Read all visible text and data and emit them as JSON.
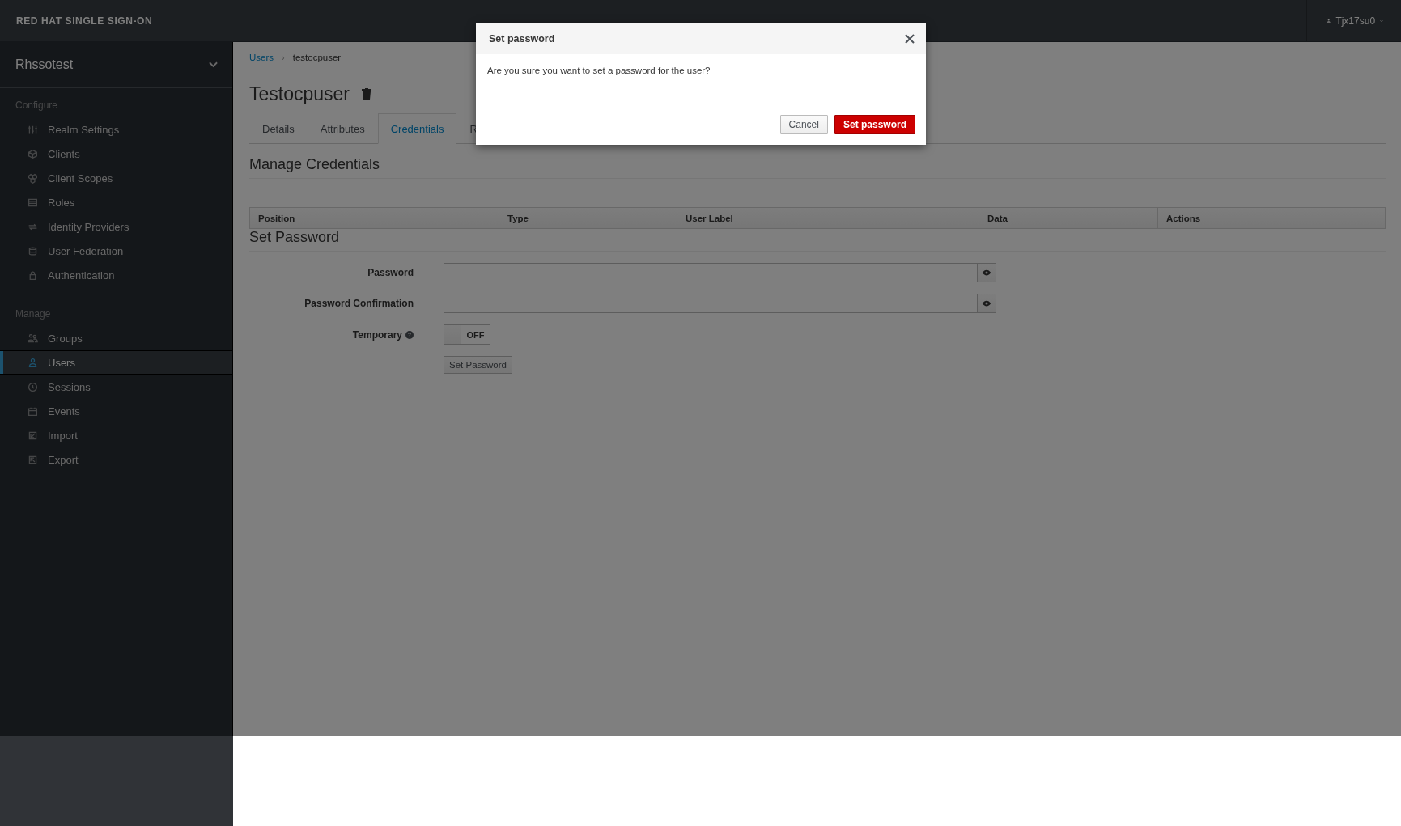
{
  "brand": "RED HAT SINGLE SIGN-ON",
  "user_menu": {
    "name": "Tjx17su0"
  },
  "realm": "Rhssotest",
  "sidebar": {
    "sections": [
      {
        "title": "Configure",
        "items": [
          {
            "label": "Realm Settings",
            "selected": false
          },
          {
            "label": "Clients",
            "selected": false
          },
          {
            "label": "Client Scopes",
            "selected": false
          },
          {
            "label": "Roles",
            "selected": false
          },
          {
            "label": "Identity Providers",
            "selected": false
          },
          {
            "label": "User Federation",
            "selected": false
          },
          {
            "label": "Authentication",
            "selected": false
          }
        ]
      },
      {
        "title": "Manage",
        "items": [
          {
            "label": "Groups",
            "selected": false
          },
          {
            "label": "Users",
            "selected": true
          },
          {
            "label": "Sessions",
            "selected": false
          },
          {
            "label": "Events",
            "selected": false
          },
          {
            "label": "Import",
            "selected": false
          },
          {
            "label": "Export",
            "selected": false
          }
        ]
      }
    ]
  },
  "breadcrumb": {
    "separator": "›",
    "items": [
      {
        "label": "Users",
        "kind": "link"
      },
      {
        "label": "testocpuser",
        "kind": "current"
      }
    ]
  },
  "title": "Testocpuser",
  "tabs": [
    {
      "label": "Details",
      "selected": false
    },
    {
      "label": "Attributes",
      "selected": false
    },
    {
      "label": "Credentials",
      "selected": true
    },
    {
      "label": "R",
      "selected": false
    }
  ],
  "manage_credentials": {
    "heading": "Manage Credentials",
    "columns": [
      "Position",
      "Type",
      "User Label",
      "Data",
      "Actions"
    ]
  },
  "set_password": {
    "heading": "Set Password",
    "fields": [
      {
        "label": "Password",
        "kind": "password"
      },
      {
        "label": "Password Confirmation",
        "kind": "password"
      },
      {
        "label": "Temporary",
        "kind": "toggle",
        "on": false,
        "toggle_text": "OFF"
      }
    ],
    "button": "Set Password"
  },
  "dialog": {
    "title": "Set password",
    "message": "Are you sure you want to set a password for the user?",
    "buttons": [
      {
        "label": "Cancel",
        "kind": "default"
      },
      {
        "label": "Set password",
        "kind": "primary"
      }
    ]
  }
}
